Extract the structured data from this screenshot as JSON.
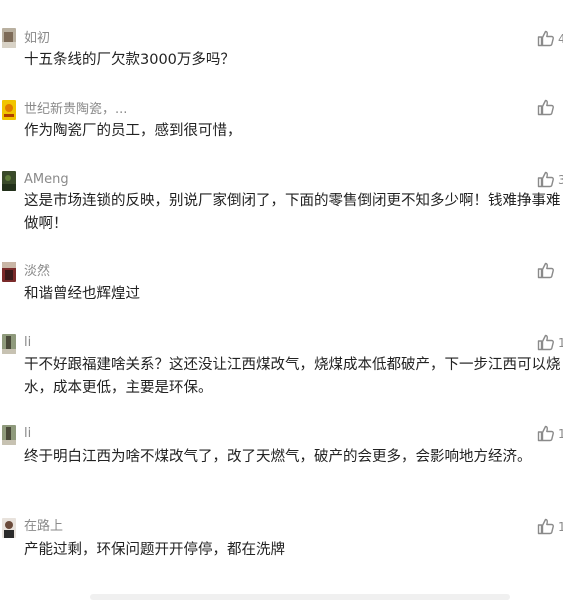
{
  "comments": [
    {
      "name": "如初",
      "text": "十五条线的厂欠款3000万多吗？",
      "likes": "4"
    },
    {
      "name": "世纪新贵陶瓷，...",
      "text": "作为陶瓷厂的员工，感到很可惜，",
      "likes": ""
    },
    {
      "name": "AMeng",
      "text": "这是市场连锁的反映，别说厂家倒闭了，下面的零售倒闭更不知多少啊！钱难挣事难做啊！",
      "likes": "3"
    },
    {
      "name": "淡然",
      "text": "和谐曾经也辉煌过",
      "likes": ""
    },
    {
      "name": "li",
      "text": "干不好跟福建啥关系？这还没让江西煤改气，烧煤成本低都破产，下一步江西可以烧水，成本更低，主要是环保。",
      "likes": "1"
    },
    {
      "name": "li",
      "text": "终于明白江西为啥不煤改气了，改了天燃气，破产的会更多，会影响地方经济。",
      "likes": "1"
    },
    {
      "name": "在路上",
      "text": "产能过剩，环保问题开开停停，都在洗牌",
      "likes": "1"
    }
  ],
  "colors": {
    "name": "#8a8a8a",
    "text": "#222222",
    "icon": "#8a8a8a"
  },
  "icons": {
    "like": "thumbs-up-icon"
  }
}
